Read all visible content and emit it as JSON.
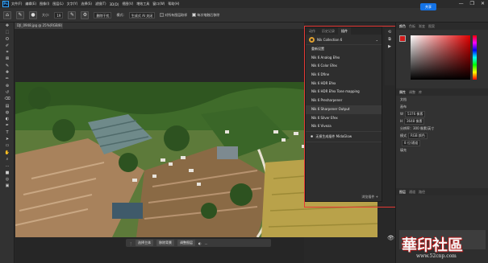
{
  "menubar": {
    "logo": "Ps",
    "items": [
      "文件(F)",
      "编辑(E)",
      "图像(I)",
      "图层(L)",
      "文字(Y)",
      "选择(S)",
      "滤镜(T)",
      "3D(D)",
      "视图(V)",
      "增效工具",
      "窗口(W)",
      "帮助(H)"
    ],
    "window_controls": [
      "—",
      "❐",
      "✕"
    ]
  },
  "options": {
    "size_label": "大小:",
    "size_value": "19",
    "mode_button": "删除干扰",
    "mode_label": "模式:",
    "mode_value": "生成式 AI 关闭",
    "sample_all": "对所有图层取样",
    "always_stroke": "每次笔触后移除",
    "share": "共享"
  },
  "document": {
    "tab_title": "DJI_0948.jpg @ 25%(RGB/8)"
  },
  "toolbar": {
    "tools": [
      "move-tool",
      "marquee-tool",
      "lasso-tool",
      "quick-select-tool",
      "crop-tool",
      "frame-tool",
      "eyedropper-tool",
      "healing-brush-tool",
      "brush-tool",
      "stamp-tool",
      "history-brush-tool",
      "eraser-tool",
      "gradient-tool",
      "blur-tool",
      "dodge-tool",
      "pen-tool",
      "type-tool",
      "path-select-tool",
      "shape-tool",
      "hand-tool",
      "zoom-tool",
      "edit-toolbar",
      "color-swatch",
      "quick-mask",
      "screen-mode"
    ],
    "glyphs": [
      "✥",
      "⬚",
      "ʘ",
      "✐",
      "⌗",
      "⊠",
      "✎",
      "✚",
      "✏",
      "⊛",
      "↺",
      "⌫",
      "▤",
      "◍",
      "◐",
      "✒",
      "T",
      "➤",
      "▭",
      "✋",
      "⌕",
      "…",
      "■",
      "◎",
      "▣"
    ]
  },
  "plugin_panel": {
    "tabs": [
      "动作",
      "历史记录",
      "插件"
    ],
    "active_tab": 2,
    "collection": "Nik Collection 6",
    "items": [
      "重新设置",
      "Nik 6 Analog Efex",
      "Nik 6 Color Efex",
      "Nik 6 Dfine",
      "Nik 6 HDR Efex",
      "Nik 6 HDR Efex Tone mapping",
      "Nik 6 Presharpener",
      "Nik 6 Sharpener Output",
      "Nik 6 Silver Efex",
      "Nik 6 Viveza"
    ],
    "selected_index": 7,
    "genai": "无损生成插件 MidoGlow",
    "footer": "浏览插件"
  },
  "right_dock": {
    "top_tabs": [
      "颜色",
      "色板",
      "渐变",
      "图案"
    ],
    "props_tabs": [
      "属性",
      "调整",
      "库"
    ],
    "doc_label": "文档",
    "canvas_label": "画布",
    "w_label": "W",
    "w_value": "5376 像素",
    "h_label": "H",
    "h_value": "3648 像素",
    "resolution": "分辨率：300 像素/英寸",
    "mode_label": "模式",
    "mode_value": "RGB 颜色",
    "bit_value": "8 位/通道",
    "fill_label": "填充",
    "layers_tabs": [
      "图层",
      "通道",
      "路径"
    ]
  },
  "taskbar": {
    "select_subject": "选择主体",
    "remove_bg": "移除背景",
    "adjust": "调整图层"
  },
  "watermark": {
    "text": "華印社區",
    "url": "www.52cnp.com"
  },
  "colors": {
    "accent": "#1473e6",
    "highlight_box": "#e53935",
    "foreground": "#d21a1a",
    "background": "#ffffff"
  }
}
